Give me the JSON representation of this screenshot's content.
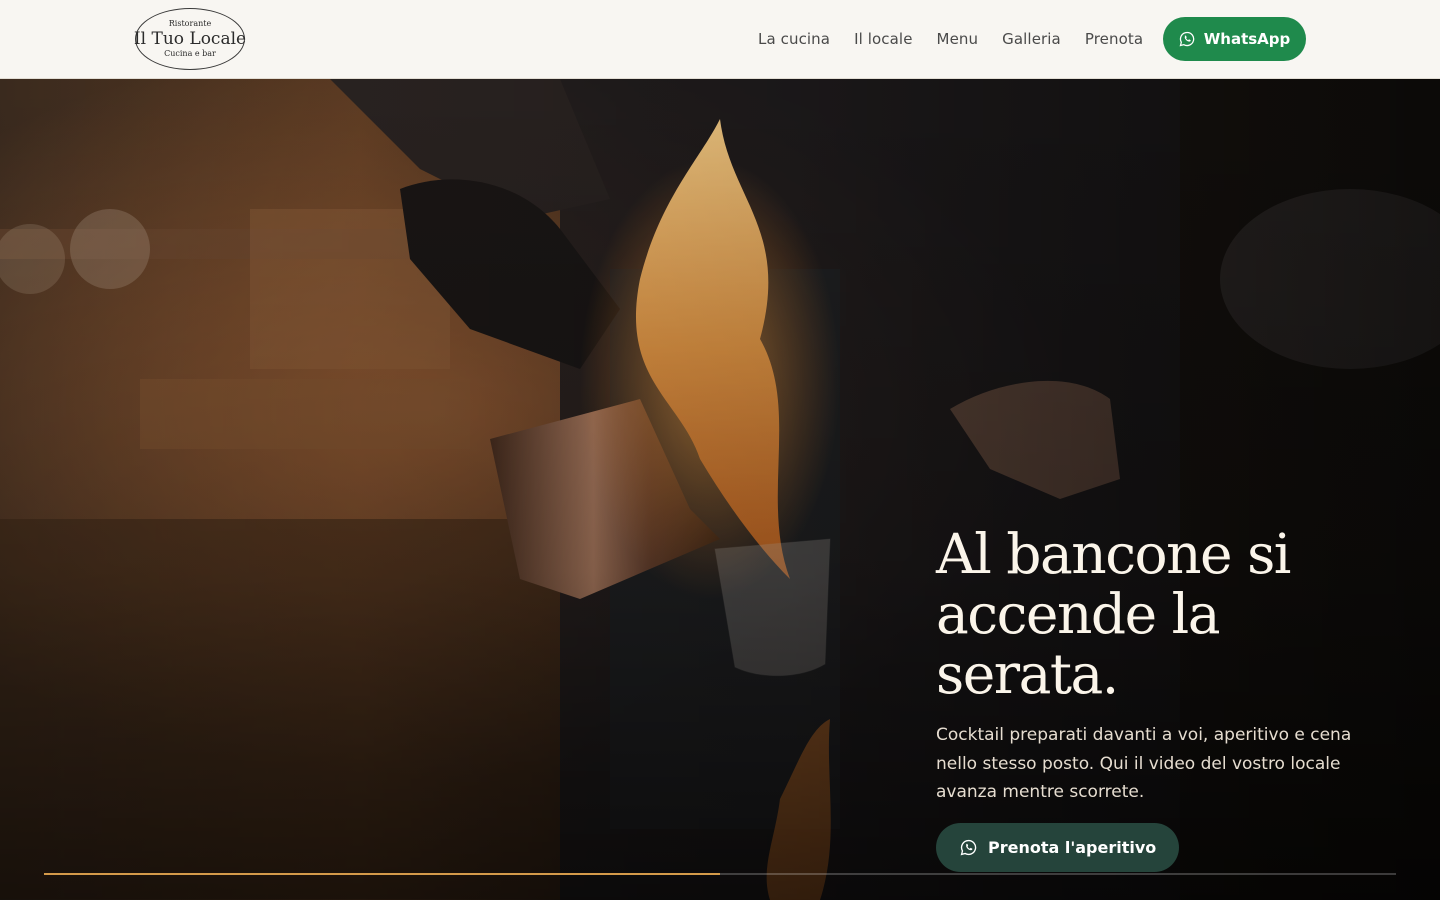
{
  "brand": {
    "top": "Ristorante",
    "name": "Il Tuo Locale",
    "sub": "Cucina e bar"
  },
  "nav": {
    "items": [
      "La cucina",
      "Il locale",
      "Menu",
      "Galleria",
      "Prenota"
    ]
  },
  "header_cta": {
    "label": "WhatsApp",
    "icon": "whatsapp-icon",
    "color": "#1f8a4c"
  },
  "hero": {
    "headline": "Al bancone si accende la serata.",
    "text": "Cocktail preparati davanti a voi, aperitivo e cena nello stesso posto. Qui il video del vostro locale avanza mentre scorrete.",
    "cta_label": "Prenota l'aperitivo",
    "cta_icon": "whatsapp-icon",
    "cta_color": "#25443b",
    "video_progress": 0.5,
    "progress_color": "#d49a4a"
  }
}
